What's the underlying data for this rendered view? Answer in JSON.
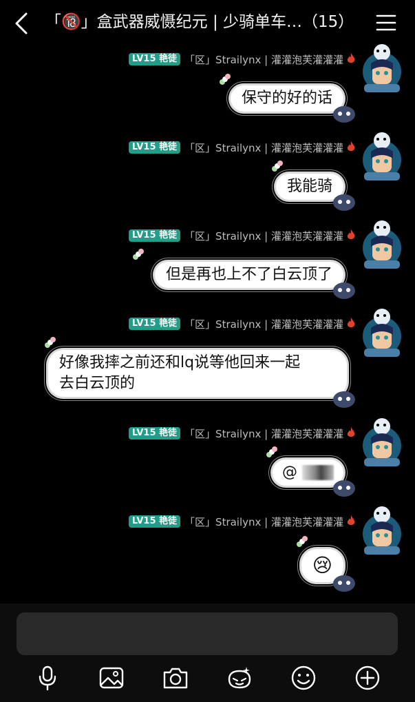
{
  "header": {
    "back_icon": "chevron-left-icon",
    "title": "「🔞」盒武器威慑纪元 | 少骑单车…（15）",
    "menu_icon": "hamburger-menu-icon"
  },
  "messages": [
    {
      "level": "LV15",
      "badge": "艳徒",
      "sender": "「区」Strailynx | 灌灌泡芙灌灌灌",
      "text": "保守的好的话"
    },
    {
      "level": "LV15",
      "badge": "艳徒",
      "sender": "「区」Strailynx | 灌灌泡芙灌灌灌",
      "text": "我能骑"
    },
    {
      "level": "LV15",
      "badge": "艳徒",
      "sender": "「区」Strailynx | 灌灌泡芙灌灌灌",
      "text": "但是再也上不了白云顶了"
    },
    {
      "level": "LV15",
      "badge": "艳徒",
      "sender": "「区」Strailynx | 灌灌泡芙灌灌灌",
      "text_line1": "好像我摔之前还和lq说等他回来一起",
      "text_line2": "去白云顶的"
    },
    {
      "level": "LV15",
      "badge": "艳徒",
      "sender": "「区」Strailynx | 灌灌泡芙灌灌灌",
      "text": "@"
    },
    {
      "level": "LV15",
      "badge": "艳徒",
      "sender": "「区」Strailynx | 灌灌泡芙灌灌灌",
      "text": "😢"
    }
  ],
  "toolbar": [
    "microphone-icon",
    "image-icon",
    "camera-icon",
    "sticker-icon",
    "emoji-icon",
    "plus-icon"
  ],
  "colors": {
    "level_badge": "#1f9e8a",
    "background": "#000000",
    "bubble": "#ffffff",
    "input": "#2a2a2a"
  }
}
